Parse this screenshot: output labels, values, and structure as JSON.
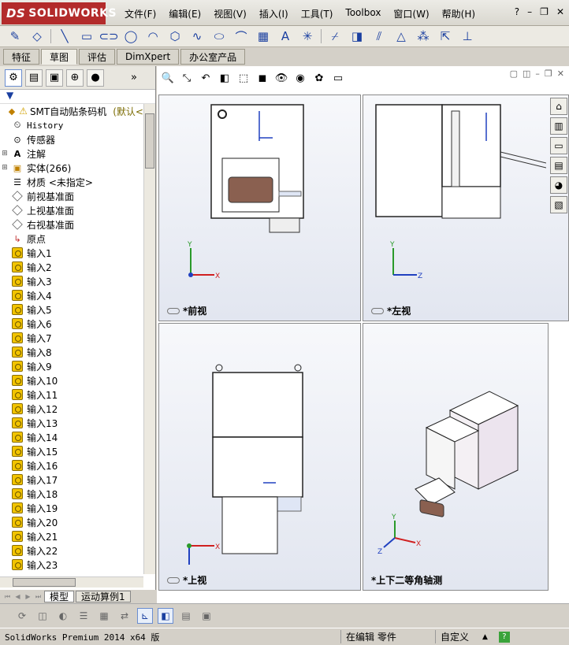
{
  "app": {
    "logo_text": "SOLIDWORKS",
    "logo_prefix": "DS"
  },
  "menu": [
    "文件(F)",
    "编辑(E)",
    "视图(V)",
    "插入(I)",
    "工具(T)",
    "Toolbox",
    "窗口(W)",
    "帮助(H)"
  ],
  "command_tabs": [
    "特征",
    "草图",
    "评估",
    "DimXpert",
    "办公室产品"
  ],
  "active_command_tab": "草图",
  "tree": {
    "root": "SMT自动贴条码机",
    "root_config": "(默认<",
    "history": "History",
    "sensors": "传感器",
    "annotations": "注解",
    "bodies": "实体(266)",
    "material": "材质 <未指定>",
    "front_plane": "前视基准面",
    "top_plane": "上视基准面",
    "right_plane": "右视基准面",
    "origin": "原点",
    "imports": [
      "输入1",
      "输入2",
      "输入3",
      "输入4",
      "输入5",
      "输入6",
      "输入7",
      "输入8",
      "输入9",
      "输入10",
      "输入11",
      "输入12",
      "输入13",
      "输入14",
      "输入15",
      "输入16",
      "输入17",
      "输入18",
      "输入19",
      "输入20",
      "输入21",
      "输入22",
      "输入23"
    ]
  },
  "bottom_tabs": [
    "模型",
    "运动算例1"
  ],
  "viewports": {
    "front": "*前视",
    "left": "*左视",
    "top": "*上视",
    "iso": "*上下二等角轴测"
  },
  "status": {
    "product": "SolidWorks Premium 2014 x64 版",
    "mode": "在编辑 零件",
    "units": "自定义"
  },
  "colors": {
    "logo_red": "#b32b2b",
    "axis_x": "#d02020",
    "axis_y": "#2a9a2a",
    "axis_z": "#2040c0"
  }
}
